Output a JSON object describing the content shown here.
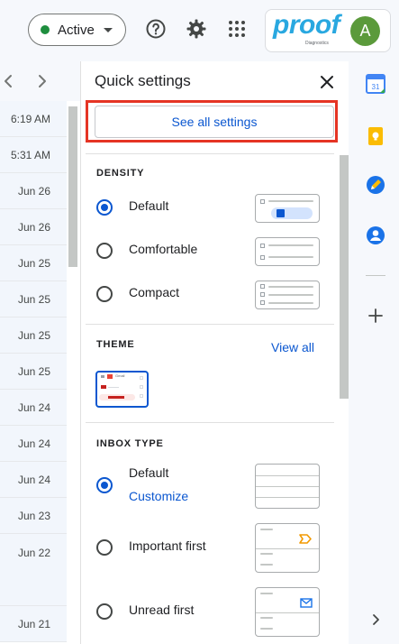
{
  "header": {
    "status": {
      "label": "Active",
      "color": "#1e8e3e"
    },
    "icons": [
      "help-icon",
      "settings-gear-icon",
      "apps-grid-icon"
    ],
    "brand": {
      "name": "proof",
      "tagline": "Diagnostics",
      "color": "#29a8e0"
    },
    "avatar": {
      "initial": "A",
      "color": "#5b9a3b"
    }
  },
  "mail_list": {
    "nav": [
      "chevron-left-icon",
      "chevron-right-icon"
    ],
    "dates": [
      "6:19 AM",
      "5:31 AM",
      "Jun 26",
      "Jun 26",
      "Jun 25",
      "Jun 25",
      "Jun 25",
      "Jun 25",
      "Jun 24",
      "Jun 24",
      "Jun 24",
      "Jun 23",
      "Jun 22",
      "Jun 21"
    ]
  },
  "quick_settings": {
    "title": "Quick settings",
    "see_all_label": "See all settings",
    "highlight_color": "#e53424",
    "accent_color": "#0b57d0",
    "density": {
      "title": "DENSITY",
      "options": [
        {
          "label": "Default",
          "selected": true
        },
        {
          "label": "Comfortable",
          "selected": false
        },
        {
          "label": "Compact",
          "selected": false
        }
      ]
    },
    "theme": {
      "title": "THEME",
      "view_all_label": "View all",
      "thumb_label": "Gmail"
    },
    "inbox_type": {
      "title": "INBOX TYPE",
      "options": [
        {
          "label": "Default",
          "link": "Customize",
          "selected": true
        },
        {
          "label": "Important first",
          "selected": false
        },
        {
          "label": "Unread first",
          "selected": false
        }
      ]
    }
  },
  "side_panel": {
    "apps": [
      "calendar-icon",
      "keep-icon",
      "tasks-icon",
      "contacts-icon"
    ],
    "calendar_day": "31",
    "add_icon": "plus-icon",
    "expand_icon": "chevron-right-icon"
  }
}
